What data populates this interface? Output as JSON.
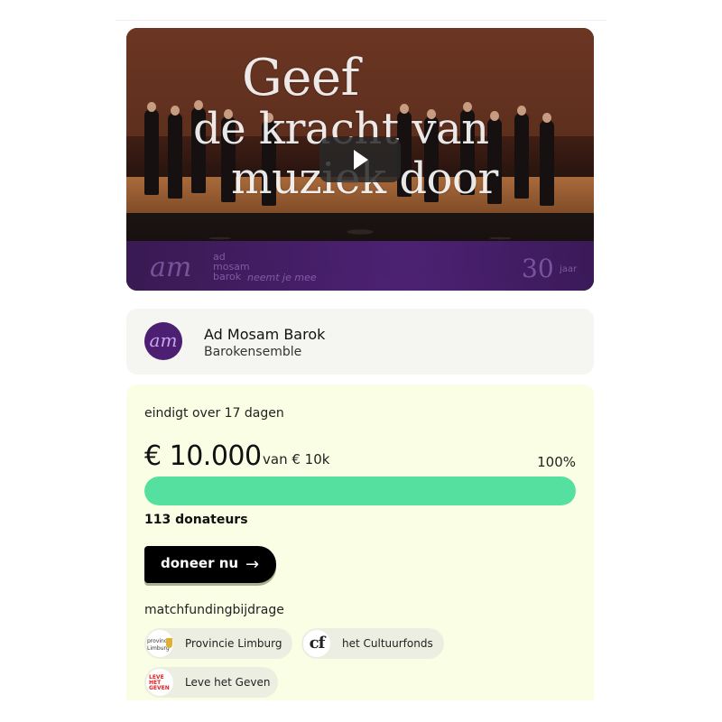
{
  "video": {
    "headline_line1": "Geef",
    "headline_line2": "de kracht van",
    "headline_line3": "muziek door",
    "logo_mark": "am",
    "logo_text_1": "ad",
    "logo_text_2": "mosam",
    "logo_text_3": "barok",
    "tagline": "neemt je mee",
    "anniversary_number": "30",
    "anniversary_label": "jaar"
  },
  "organization": {
    "avatar_text": "am",
    "name": "Ad Mosam Barok",
    "type": "Barokensemble"
  },
  "campaign": {
    "ends_text": "eindigt over 17 dagen",
    "amount_raised": "€ 10.000",
    "goal_text": "van € 10k",
    "percent_text": "100%",
    "progress_fraction": 1.0,
    "donors_text": "113 donateurs",
    "donate_label": "doneer nu",
    "donate_arrow": "→",
    "matchfunding_label": "matchfundingbijdrage",
    "partners": [
      {
        "name": "Provincie Limburg",
        "logo_text": "provincie Limburg"
      },
      {
        "name": "het Cultuurfonds",
        "logo_text": "cf"
      },
      {
        "name": "Leve het Geven",
        "logo_text_1": "LEVE",
        "logo_text_2": "HET",
        "logo_text_3": "GEVEN"
      }
    ]
  },
  "colors": {
    "progress_fill": "#56e0a0",
    "funding_card_bg": "#fafee4",
    "org_card_bg": "#f5f5f2",
    "video_band": "#4e2277",
    "button_bg": "#000000"
  }
}
